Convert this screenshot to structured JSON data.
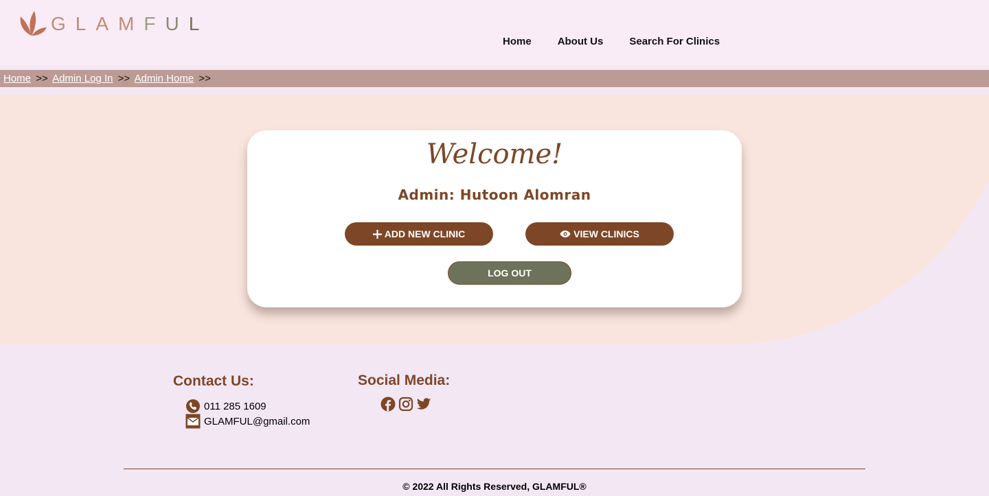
{
  "brand": {
    "letters": [
      "G",
      "L",
      "A",
      "M",
      "F",
      "U",
      "L"
    ],
    "letter_colors": [
      "#c28b78",
      "#c28b78",
      "#c28b78",
      "#c28b78",
      "#9c9d86",
      "#8a8d74",
      "#7c6f5e"
    ],
    "accent": "#c0715a"
  },
  "nav": {
    "items": [
      {
        "label": "Home"
      },
      {
        "label": "About Us"
      },
      {
        "label": "Search For Clinics"
      }
    ]
  },
  "breadcrumb": {
    "items": [
      {
        "label": "Home"
      },
      {
        "label": "Admin Log In"
      },
      {
        "label": "Admin Home"
      }
    ],
    "separator": ">>"
  },
  "card": {
    "welcome": "Welcome!",
    "admin": "Admin: Hutoon Alomran",
    "add_label": "ADD NEW CLINIC",
    "view_label": "VIEW CLINICS",
    "logout_label": "LOG OUT"
  },
  "footer": {
    "contact_title": "Contact Us:",
    "phone": "011 285 1609",
    "email": "GLAMFUL@gmail.com",
    "social_title": "Social Media:",
    "social_icons": [
      "facebook-icon",
      "instagram-icon",
      "twitter-icon"
    ],
    "copyright": "© 2022 All Rights Reserved, GLAMFUL®"
  },
  "colors": {
    "brown": "#7d4727",
    "olive": "#6c735a",
    "breadcrumb_bg": "#bc9b95",
    "hero_bg": "#f9e5de",
    "page_bg": "#f4e7f4"
  }
}
